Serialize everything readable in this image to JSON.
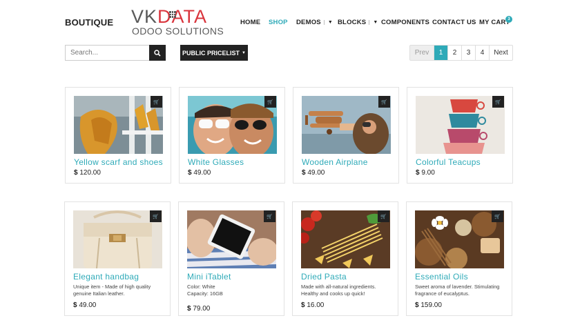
{
  "header": {
    "brand": "BOUTIQUE",
    "logo_line1_a": "VK",
    "logo_line1_b": "DATA",
    "logo_line2": "ODOO SOLUTIONS",
    "nav": [
      {
        "label": "HOME"
      },
      {
        "label": "SHOP"
      },
      {
        "label": "DEMOS"
      },
      {
        "label": "BLOCKS"
      },
      {
        "label": "COMPONENTS"
      },
      {
        "label": "CONTACT US"
      },
      {
        "label": "MY CART"
      }
    ],
    "cart_count": "3",
    "accent_color": "#2eaab8"
  },
  "toolbar": {
    "search_placeholder": "Search...",
    "pricelist_label": "PUBLIC PRICELIST",
    "pager": {
      "prev": "Prev",
      "pages": [
        "1",
        "2",
        "3",
        "4"
      ],
      "current": "1",
      "next": "Next"
    }
  },
  "products": [
    {
      "name": "Yellow scarf and shoes",
      "currency": "$",
      "price": "120.00",
      "desc": ""
    },
    {
      "name": "White Glasses",
      "currency": "$",
      "price": "49.00",
      "desc": ""
    },
    {
      "name": "Wooden Airplane",
      "currency": "$",
      "price": "49.00",
      "desc": ""
    },
    {
      "name": "Colorful Teacups",
      "currency": "$",
      "price": "9.00",
      "desc": ""
    },
    {
      "name": "Elegant handbag",
      "currency": "$",
      "price": "49.00",
      "desc": "Unique item - Made of high quality genuine Italian leather."
    },
    {
      "name": "Mini iTablet",
      "currency": "$",
      "price": "79.00",
      "desc": "Color: White\nCapacity: 16GB"
    },
    {
      "name": "Dried Pasta",
      "currency": "$",
      "price": "16.00",
      "desc": "Made with all-natural ingredients. Healthy and cooks up quick!"
    },
    {
      "name": "Essential Oils",
      "currency": "$",
      "price": "159.00",
      "desc": "Sweet aroma of lavender. Stimulating fragrance of eucalyptus."
    }
  ]
}
